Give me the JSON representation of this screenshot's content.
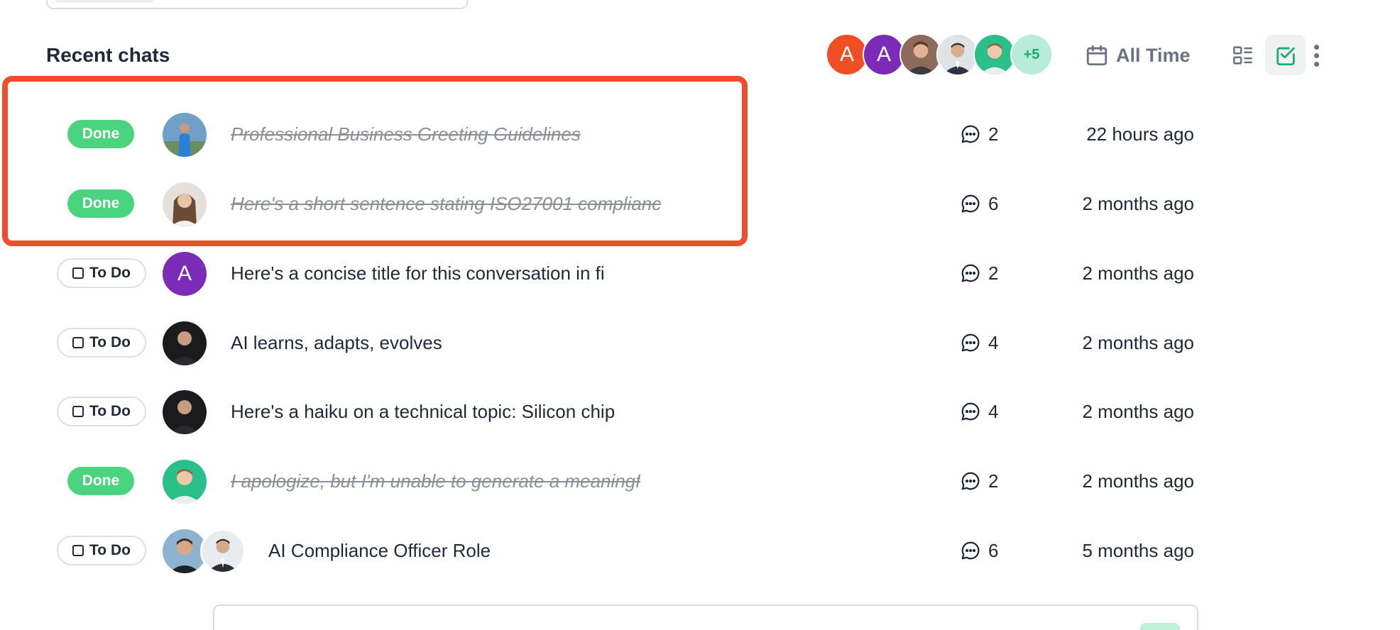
{
  "section": {
    "title": "Recent chats"
  },
  "participants": {
    "avatars": [
      {
        "letter": "A",
        "color": "#f04e23"
      },
      {
        "letter": "A",
        "color": "#7b2bb8"
      },
      {
        "letter": "",
        "color": "#9a6b57"
      },
      {
        "letter": "",
        "color": "#6e7a86"
      },
      {
        "letter": "",
        "color": "#2bbf8a"
      }
    ],
    "more_count": "+5"
  },
  "filter": {
    "label": "All Time",
    "icon": "calendar-icon"
  },
  "toolbar": {
    "list_view_icon": "list-view-icon",
    "task_view_icon": "checkbox-view-icon",
    "more_icon": "more-vertical-icon"
  },
  "chats": [
    {
      "status": "Done",
      "title": "Professional Business Greeting Guidelines",
      "messages": "2",
      "time": "22 hours ago"
    },
    {
      "status": "Done",
      "title": "Here's a short sentence stating ISO27001 complianc",
      "messages": "6",
      "time": "2 months ago"
    },
    {
      "status": "To Do",
      "avatar_letter": "A",
      "title": "Here's a concise title for this conversation in fi",
      "messages": "2",
      "time": "2 months ago"
    },
    {
      "status": "To Do",
      "title": "AI learns, adapts, evolves",
      "messages": "4",
      "time": "2 months ago"
    },
    {
      "status": "To Do",
      "title": "Here's a haiku on a technical topic: Silicon chip",
      "messages": "4",
      "time": "2 months ago"
    },
    {
      "status": "Done",
      "title": "I apologize, but I'm unable to generate a meaningf",
      "messages": "2",
      "time": "2 months ago"
    },
    {
      "status": "To Do",
      "title": "AI Compliance Officer Role",
      "messages": "6",
      "time": "5 months ago"
    }
  ],
  "colors": {
    "done": "#4ad47d",
    "highlight": "#f04e2a",
    "accent": "#1fa775"
  }
}
